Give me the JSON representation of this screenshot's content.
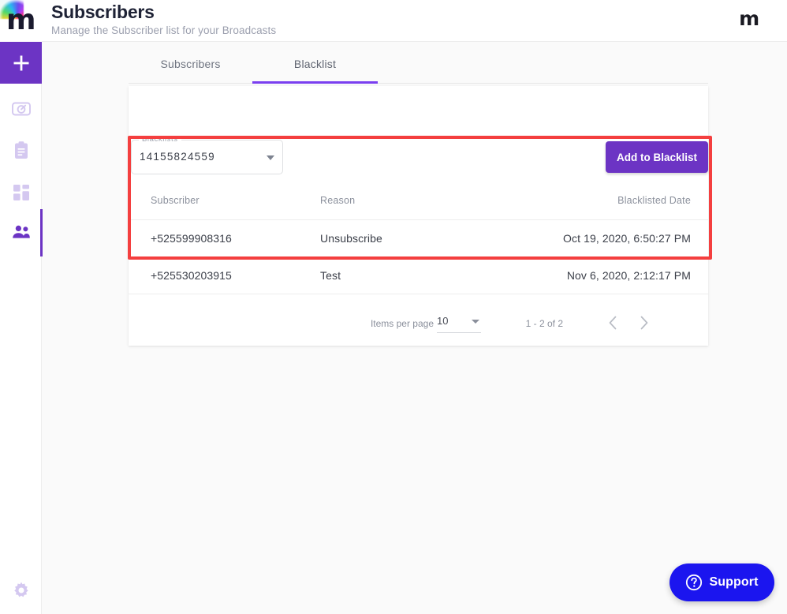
{
  "header": {
    "logo_alt": "m",
    "title": "Subscribers",
    "subtitle": "Manage the Subscriber list for your Broadcasts",
    "brand_right": "m"
  },
  "sidebar": {
    "add_label": "+",
    "items": [
      {
        "name": "add",
        "icon": "plus-icon",
        "active": true
      },
      {
        "name": "dashboard",
        "icon": "speedometer-icon",
        "active": false
      },
      {
        "name": "campaigns",
        "icon": "clipboard-icon",
        "active": false
      },
      {
        "name": "templates",
        "icon": "grid-tiles-icon",
        "active": false
      },
      {
        "name": "subscribers",
        "icon": "people-icon",
        "active": true
      }
    ],
    "settings": {
      "name": "settings",
      "icon": "gear-icon"
    }
  },
  "tabs": [
    {
      "label": "Subscribers",
      "active": false
    },
    {
      "label": "Blacklist",
      "active": true
    }
  ],
  "filter": {
    "label": "Blacklists",
    "value": "14155824559",
    "arrow_icon": "chevron-down-icon"
  },
  "actions": {
    "add_to_blacklist": "Add to Blacklist"
  },
  "table": {
    "columns": [
      "Subscriber",
      "Reason",
      "Blacklisted Date"
    ],
    "rows": [
      {
        "subscriber": "+525599908316",
        "reason": "Unsubscribe",
        "date": "Oct 19, 2020, 6:50:27 PM"
      },
      {
        "subscriber": "+525530203915",
        "reason": "Test",
        "date": "Nov 6, 2020, 2:12:17 PM"
      }
    ]
  },
  "paginator": {
    "items_per_page_label": "Items per page",
    "items_per_page_value": "10",
    "range_label": "1 - 2 of 2",
    "prev_icon": "chevron-left-icon",
    "next_icon": "chevron-right-icon"
  },
  "support": {
    "label": "Support",
    "icon": "question-circle-icon"
  },
  "colors": {
    "brand_purple": "#6c34c4",
    "tab_underline": "#7a3ff0",
    "support_blue": "#1b15ef",
    "annotation_red": "#f43f3f",
    "page_bg": "#fafafa"
  }
}
